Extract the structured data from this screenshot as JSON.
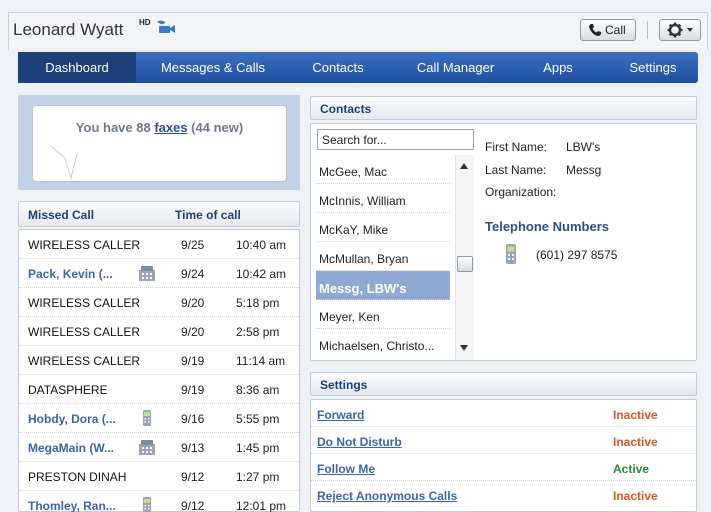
{
  "header": {
    "user_name": "Leonard Wyatt",
    "hd_badge": "HD",
    "call_label": "Call",
    "video_icon": "video-camera-icon",
    "gear_icon": "gear-icon"
  },
  "nav": {
    "tabs": [
      {
        "label": "Dashboard",
        "active": true
      },
      {
        "label": "Messages & Calls",
        "active": false
      },
      {
        "label": "Contacts",
        "active": false
      },
      {
        "label": "Call Manager",
        "active": false
      },
      {
        "label": "Apps",
        "active": false
      },
      {
        "label": "Settings",
        "active": false
      }
    ]
  },
  "fax": {
    "prefix": "You have 88 ",
    "link": "faxes",
    "suffix": " (44 new)"
  },
  "missed_calls": {
    "col_name": "Missed Call",
    "col_time": "Time of call",
    "rows": [
      {
        "name": "WIRELESS CALLER",
        "date": "9/25",
        "time": "10:40 am",
        "link": false,
        "icon": ""
      },
      {
        "name": "Pack, Kevin (...",
        "date": "9/24",
        "time": "10:42 am",
        "link": true,
        "icon": "office-phone-icon"
      },
      {
        "name": "WIRELESS CALLER",
        "date": "9/20",
        "time": "5:18 pm",
        "link": false,
        "icon": ""
      },
      {
        "name": "WIRELESS CALLER",
        "date": "9/20",
        "time": "2:58 pm",
        "link": false,
        "icon": ""
      },
      {
        "name": "WIRELESS CALLER",
        "date": "9/19",
        "time": "11:14 am",
        "link": false,
        "icon": ""
      },
      {
        "name": "DATASPHERE",
        "date": "9/19",
        "time": "8:36 am",
        "link": false,
        "icon": ""
      },
      {
        "name": "Hobdy, Dora (...",
        "date": "9/16",
        "time": "5:55 pm",
        "link": true,
        "icon": "mobile-phone-icon"
      },
      {
        "name": "MegaMain (W...",
        "date": "9/13",
        "time": "1:45 pm",
        "link": true,
        "icon": "office-phone-icon"
      },
      {
        "name": "PRESTON DINAH",
        "date": "9/12",
        "time": "1:27 pm",
        "link": false,
        "icon": ""
      },
      {
        "name": "Thomley, Ran...",
        "date": "9/12",
        "time": "12:01 pm",
        "link": true,
        "icon": "mobile-phone-icon"
      }
    ]
  },
  "contacts": {
    "title": "Contacts",
    "search_placeholder": "Search for...",
    "items": [
      {
        "name": "McGee, Mac",
        "selected": false
      },
      {
        "name": "McInnis, William",
        "selected": false
      },
      {
        "name": "McKaY, Mike",
        "selected": false
      },
      {
        "name": "McMullan, Bryan",
        "selected": false
      },
      {
        "name": "Messg, LBW's",
        "selected": true
      },
      {
        "name": "Meyer, Ken",
        "selected": false
      },
      {
        "name": "Michaelsen, Christo...",
        "selected": false
      }
    ],
    "detail": {
      "first_name_label": "First Name:",
      "first_name": "LBW's",
      "last_name_label": "Last Name:",
      "last_name": "Messg",
      "org_label": "Organization:",
      "org": "",
      "tel_header": "Telephone Numbers",
      "tel_number": "(601) 297 8575"
    }
  },
  "settings": {
    "title": "Settings",
    "rows": [
      {
        "label": "Forward",
        "status": "Inactive"
      },
      {
        "label": "Do Not Disturb",
        "status": "Inactive"
      },
      {
        "label": "Follow Me",
        "status": "Active"
      },
      {
        "label": "Reject Anonymous Calls",
        "status": "Inactive"
      }
    ]
  },
  "colors": {
    "nav_blue": "#1f4f9e",
    "link_blue": "#3d64a8",
    "inactive": "#d0582a",
    "active": "#2e8b2e",
    "selected_bg": "#8fa8d4"
  }
}
